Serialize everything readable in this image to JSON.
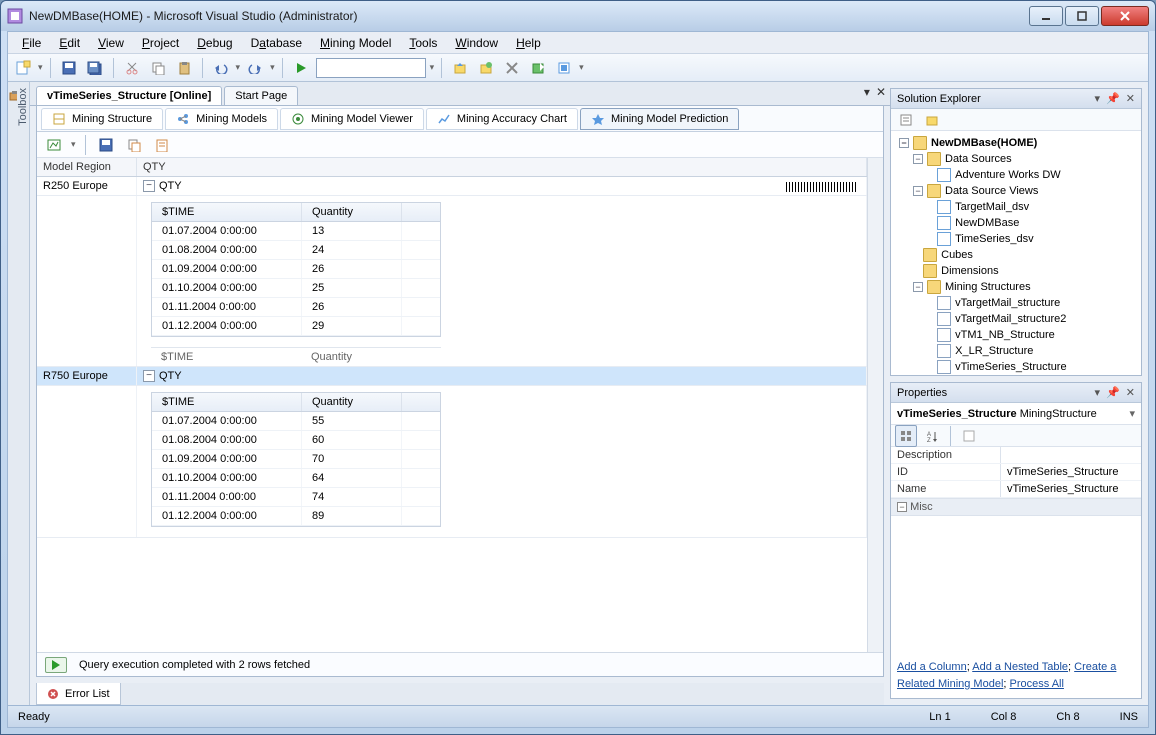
{
  "window": {
    "title": "NewDMBase(HOME) - Microsoft Visual Studio (Administrator)"
  },
  "menu": {
    "file": "File",
    "edit": "Edit",
    "view": "View",
    "project": "Project",
    "debug": "Debug",
    "database": "Database",
    "mining_model": "Mining Model",
    "tools": "Tools",
    "window": "Window",
    "help": "Help"
  },
  "doc_tabs": {
    "active": "vTimeSeries_Structure [Online]",
    "start": "Start Page"
  },
  "subtabs": {
    "structure": "Mining Structure",
    "models": "Mining Models",
    "viewer": "Mining Model Viewer",
    "accuracy": "Mining Accuracy Chart",
    "prediction": "Mining Model Prediction"
  },
  "grid": {
    "headers": {
      "model_region": "Model Region",
      "qty": "QTY"
    },
    "nested_headers": {
      "time": "$TIME",
      "quantity": "Quantity"
    },
    "peek_headers": {
      "time": "$TIME",
      "quantity": "Quantity"
    },
    "rows": [
      {
        "model_region": "R250 Europe",
        "qty_label": "QTY",
        "items": [
          {
            "t": "01.07.2004 0:00:00",
            "q": "13"
          },
          {
            "t": "01.08.2004 0:00:00",
            "q": "24"
          },
          {
            "t": "01.09.2004 0:00:00",
            "q": "26"
          },
          {
            "t": "01.10.2004 0:00:00",
            "q": "25"
          },
          {
            "t": "01.11.2004 0:00:00",
            "q": "26"
          },
          {
            "t": "01.12.2004 0:00:00",
            "q": "29"
          }
        ]
      },
      {
        "model_region": "R750 Europe",
        "qty_label": "QTY",
        "items": [
          {
            "t": "01.07.2004 0:00:00",
            "q": "55"
          },
          {
            "t": "01.08.2004 0:00:00",
            "q": "60"
          },
          {
            "t": "01.09.2004 0:00:00",
            "q": "70"
          },
          {
            "t": "01.10.2004 0:00:00",
            "q": "64"
          },
          {
            "t": "01.11.2004 0:00:00",
            "q": "74"
          },
          {
            "t": "01.12.2004 0:00:00",
            "q": "89"
          }
        ]
      }
    ]
  },
  "query_status": "Query execution completed with 2 rows fetched",
  "error_list_tab": "Error List",
  "toolbox_label": "Toolbox",
  "solution_explorer": {
    "title": "Solution Explorer",
    "root": "NewDMBase(HOME)",
    "data_sources": "Data Sources",
    "ds_item": "Adventure Works DW",
    "dsv": "Data Source Views",
    "dsv_items": [
      "TargetMail_dsv",
      "NewDMBase",
      "TimeSeries_dsv"
    ],
    "cubes": "Cubes",
    "dimensions": "Dimensions",
    "mining_structures": "Mining Structures",
    "ms_items": [
      "vTargetMail_structure",
      "vTargetMail_structure2",
      "vTM1_NB_Structure",
      "X_LR_Structure",
      "vTimeSeries_Structure"
    ]
  },
  "properties": {
    "title": "Properties",
    "object": "vTimeSeries_Structure",
    "object_type": "MiningStructure",
    "rows": {
      "description": {
        "name": "Description",
        "val": ""
      },
      "id": {
        "name": "ID",
        "val": "vTimeSeries_Structure"
      },
      "name": {
        "name": "Name",
        "val": "vTimeSeries_Structure"
      }
    },
    "cat_misc": "Misc",
    "links": {
      "add_column": "Add a Column",
      "add_nested": "Add a Nested Table",
      "create_related": "Create a Related Mining Model",
      "process_all": "Process All"
    }
  },
  "status": {
    "ready": "Ready",
    "ln": "Ln 1",
    "col": "Col 8",
    "ch": "Ch 8",
    "ins": "INS"
  }
}
